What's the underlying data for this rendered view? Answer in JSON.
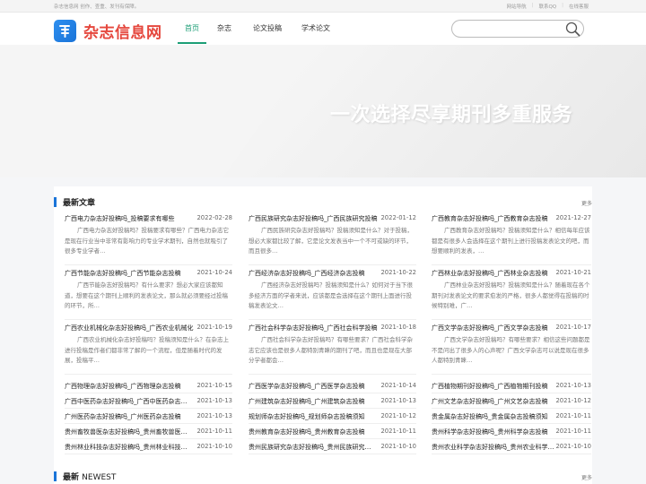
{
  "topbar": {
    "tagline": "杂志信息网 创作、查重、发刊有保障。",
    "links": [
      "网站导航",
      "联系QQ",
      "在线客服"
    ]
  },
  "header": {
    "brand": "杂志信息网",
    "nav": [
      "首页",
      "杂志",
      "论文投稿",
      "学术论文"
    ],
    "search_placeholder": ""
  },
  "banner": {
    "headline": "一次选择尽享期刊多重服务"
  },
  "latest": {
    "title": "最新文章",
    "more": "更多",
    "columns": [
      {
        "featured": [
          {
            "title": "广西电力杂志好投稿吗_投稿要求有哪些",
            "date": "2022-02-28",
            "desc": "广西电力杂志好投稿吗？投稿要求有哪些？广西电力杂志它是现在行业当中非常有影响力的专业学术期刊，自然也就吸引了很多专业学者…"
          },
          {
            "title": "广西节能杂志好投稿吗_广西节能杂志投稿",
            "date": "2021-10-24",
            "desc": "广西节能杂志好投稿吗？有什么要求？想必大家应该都知道，想要在这个期刊上顺利的发表论文，那么就必须要经过投稿的环节，所…"
          },
          {
            "title": "广西农业机械化杂志好投稿吗_广西农业机械化",
            "date": "2021-10-19",
            "desc": "广西农业机械化杂志好投稿吗？投稿须知是什么？在杂志上进行投稿是作者们都非常了解的一个流程，但是随着时代的发展，投稿平…"
          }
        ],
        "list": [
          {
            "title": "广西物理杂志好投稿吗_广西物理杂志投稿",
            "date": "2021-10-15"
          },
          {
            "title": "广西中医药杂志好投稿吗_广西中医药杂志投稿",
            "date": "2021-10-13"
          },
          {
            "title": "广州医药杂志好投稿吗_广州医药杂志投稿",
            "date": "2021-10-13"
          },
          {
            "title": "贵州畜牧兽医杂志好投稿吗_贵州畜牧兽医投稿",
            "date": "2021-10-11"
          },
          {
            "title": "贵州林业科技杂志好投稿吗_贵州林业科技投稿",
            "date": "2021-10-10"
          }
        ]
      },
      {
        "featured": [
          {
            "title": "广西民族研究杂志好投稿吗_广西民族研究投稿",
            "date": "2022-01-12",
            "desc": "广西民族研究杂志好投稿吗？投稿须知是什么？对于投稿，想必大家都比较了解，它是论文发表当中一个不可或缺的环节，而且很多…"
          },
          {
            "title": "广西经济杂志好投稿吗_广西经济杂志投稿",
            "date": "2021-10-22",
            "desc": "广西经济杂志好投稿吗？投稿须知是什么？如何对于当下很多经济方面的学者来说，应该都是会选择在这个期刊上面进行投稿发表论文…"
          },
          {
            "title": "广西社会科学杂志好投稿吗_广西社会科学投稿",
            "date": "2021-10-18",
            "desc": "广西社会科学杂志好投稿吗？有哪些要求？广西社会科学杂志它应该也是很多人都特别青睐的期刊了吧，而且也是现在大部分学者都会…"
          }
        ],
        "list": [
          {
            "title": "广西医学杂志好投稿吗_广西医学杂志投稿",
            "date": "2021-10-14"
          },
          {
            "title": "广州建筑杂志好投稿吗_广州建筑杂志投稿",
            "date": "2021-10-13"
          },
          {
            "title": "规划师杂志好投稿吗_规划师杂志投稿须知",
            "date": "2021-10-12"
          },
          {
            "title": "贵州教育杂志好投稿吗_贵州教育杂志投稿",
            "date": "2021-10-11"
          },
          {
            "title": "贵州民族研究杂志好投稿吗_贵州民族研究投稿",
            "date": "2021-10-10"
          }
        ]
      },
      {
        "featured": [
          {
            "title": "广西教育杂志好投稿吗_广西教育杂志投稿",
            "date": "2021-12-27",
            "desc": "广西教育杂志好投稿吗？投稿须知是什么？相信每年应该都是有很多人会选择在这个期刊上进行投稿发表论文的吧，而想要顺利的发表，…"
          },
          {
            "title": "广西林业杂志好投稿吗_广西林业杂志投稿",
            "date": "2021-10-21",
            "desc": "广西林业杂志好投稿吗？投稿须知是什么？随着现在各个期刊对发表论文的要求愈发的严格，很多人都觉得在投稿的时候特别难，广…"
          },
          {
            "title": "广西文学杂志好投稿吗_广西文学杂志投稿",
            "date": "2021-10-17",
            "desc": "广西文学杂志好投稿吗？有哪些要求？相信这些问题都是不是问出了很多人的心声呢？广西文学杂志可以说是现在很多人都特别青睐…"
          }
        ],
        "list": [
          {
            "title": "广西植物期刊好投稿吗_广西植物期刊投稿",
            "date": "2021-10-13"
          },
          {
            "title": "广州文艺杂志好投稿吗_广州文艺杂志投稿",
            "date": "2021-10-12"
          },
          {
            "title": "贵金属杂志好投稿吗_贵金属杂志投稿须知",
            "date": "2021-10-11"
          },
          {
            "title": "贵州科学杂志好投稿吗_贵州科学杂志投稿",
            "date": "2021-10-11"
          },
          {
            "title": "贵州农业科学杂志好投稿吗_贵州农业科学投稿",
            "date": "2021-10-10"
          }
        ]
      }
    ]
  },
  "newest": {
    "title_cn": "最新",
    "title_en": "NEWEST",
    "more": "更多"
  },
  "colors": {
    "accent": "#1c9e76",
    "brand_red": "#e5473d",
    "logo_blue": "#1a74d8"
  }
}
